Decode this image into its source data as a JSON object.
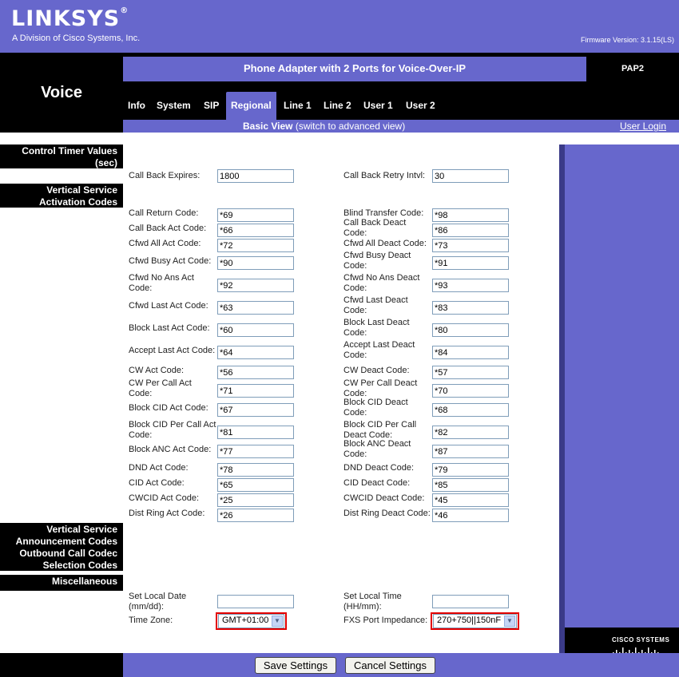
{
  "header": {
    "brand": "LINKSYS",
    "tagline": "A Division of Cisco Systems, Inc.",
    "firmware": "Firmware Version: 3.1.15(LS)"
  },
  "section_title": "Voice",
  "product_title": "Phone Adapter with 2 Ports for Voice-Over-IP",
  "product_model": "PAP2",
  "tabs": [
    "Info",
    "System",
    "SIP",
    "Regional",
    "Line 1",
    "Line 2",
    "User 1",
    "User 2"
  ],
  "active_tab": "Regional",
  "view": {
    "basic": "Basic View",
    "switch": "(switch to advanced view)",
    "user_login": "User Login"
  },
  "groups": {
    "control_timer": "Control Timer Values (sec)",
    "vsac": "Vertical Service Activation Codes",
    "vsann": "Vertical Service Announcement Codes",
    "outbound": "Outbound Call Codec Selection Codes",
    "misc": "Miscellaneous"
  },
  "timer_fields": [
    {
      "label": "Call Back Expires:",
      "value": "1800"
    },
    {
      "label": "Call Back Retry Intvl:",
      "value": "30"
    }
  ],
  "vsac_rows": [
    {
      "left_label": "Call Return Code:",
      "left_value": "*69",
      "right_label": "Blind Transfer Code:",
      "right_value": "*98"
    },
    {
      "left_label": "Call Back Act Code:",
      "left_value": "*66",
      "right_label": "Call Back Deact Code:",
      "right_value": "*86"
    },
    {
      "left_label": "Cfwd All Act Code:",
      "left_value": "*72",
      "right_label": "Cfwd All Deact Code:",
      "right_value": "*73"
    },
    {
      "left_label": "Cfwd Busy Act Code:",
      "left_value": "*90",
      "right_label": "Cfwd Busy Deact Code:",
      "right_value": "*91"
    },
    {
      "left_label": "Cfwd No Ans Act Code:",
      "left_value": "*92",
      "right_label": "Cfwd No Ans Deact Code:",
      "right_value": "*93"
    },
    {
      "left_label": "Cfwd Last Act Code:",
      "left_value": "*63",
      "right_label": "Cfwd Last Deact Code:",
      "right_value": "*83"
    },
    {
      "left_label": "Block Last Act Code:",
      "left_value": "*60",
      "right_label": "Block Last Deact Code:",
      "right_value": "*80"
    },
    {
      "left_label": "Accept Last Act Code:",
      "left_value": "*64",
      "right_label": "Accept Last Deact Code:",
      "right_value": "*84"
    },
    {
      "left_label": "CW Act Code:",
      "left_value": "*56",
      "right_label": "CW Deact Code:",
      "right_value": "*57"
    },
    {
      "left_label": "CW Per Call Act Code:",
      "left_value": "*71",
      "right_label": "CW Per Call Deact Code:",
      "right_value": "*70"
    },
    {
      "left_label": "Block CID Act Code:",
      "left_value": "*67",
      "right_label": "Block CID Deact Code:",
      "right_value": "*68"
    },
    {
      "left_label": "Block CID Per Call Act Code:",
      "left_value": "*81",
      "right_label": "Block CID Per Call Deact Code:",
      "right_value": "*82"
    },
    {
      "left_label": "Block ANC Act Code:",
      "left_value": "*77",
      "right_label": "Block ANC Deact Code:",
      "right_value": "*87"
    },
    {
      "left_label": "DND Act Code:",
      "left_value": "*78",
      "right_label": "DND Deact Code:",
      "right_value": "*79"
    },
    {
      "left_label": "CID Act Code:",
      "left_value": "*65",
      "right_label": "CID Deact Code:",
      "right_value": "*85"
    },
    {
      "left_label": "CWCID Act Code:",
      "left_value": "*25",
      "right_label": "CWCID Deact Code:",
      "right_value": "*45"
    },
    {
      "left_label": "Dist Ring Act Code:",
      "left_value": "*26",
      "right_label": "Dist Ring Deact Code:",
      "right_value": "*46"
    }
  ],
  "misc": {
    "local_date_label": "Set Local Date (mm/dd):",
    "local_date_value": "",
    "local_time_label": "Set Local Time (HH/mm):",
    "local_time_value": "",
    "timezone_label": "Time Zone:",
    "timezone_value": "GMT+01:00",
    "fxs_label": "FXS Port Impedance:",
    "fxs_value": "270+750||150nF"
  },
  "cisco_logo": "CISCO SYSTEMS",
  "buttons": {
    "save": "Save Settings",
    "cancel": "Cancel Settings"
  },
  "colors": {
    "brand_purple": "#6767cc",
    "highlight_red": "#e30000"
  }
}
